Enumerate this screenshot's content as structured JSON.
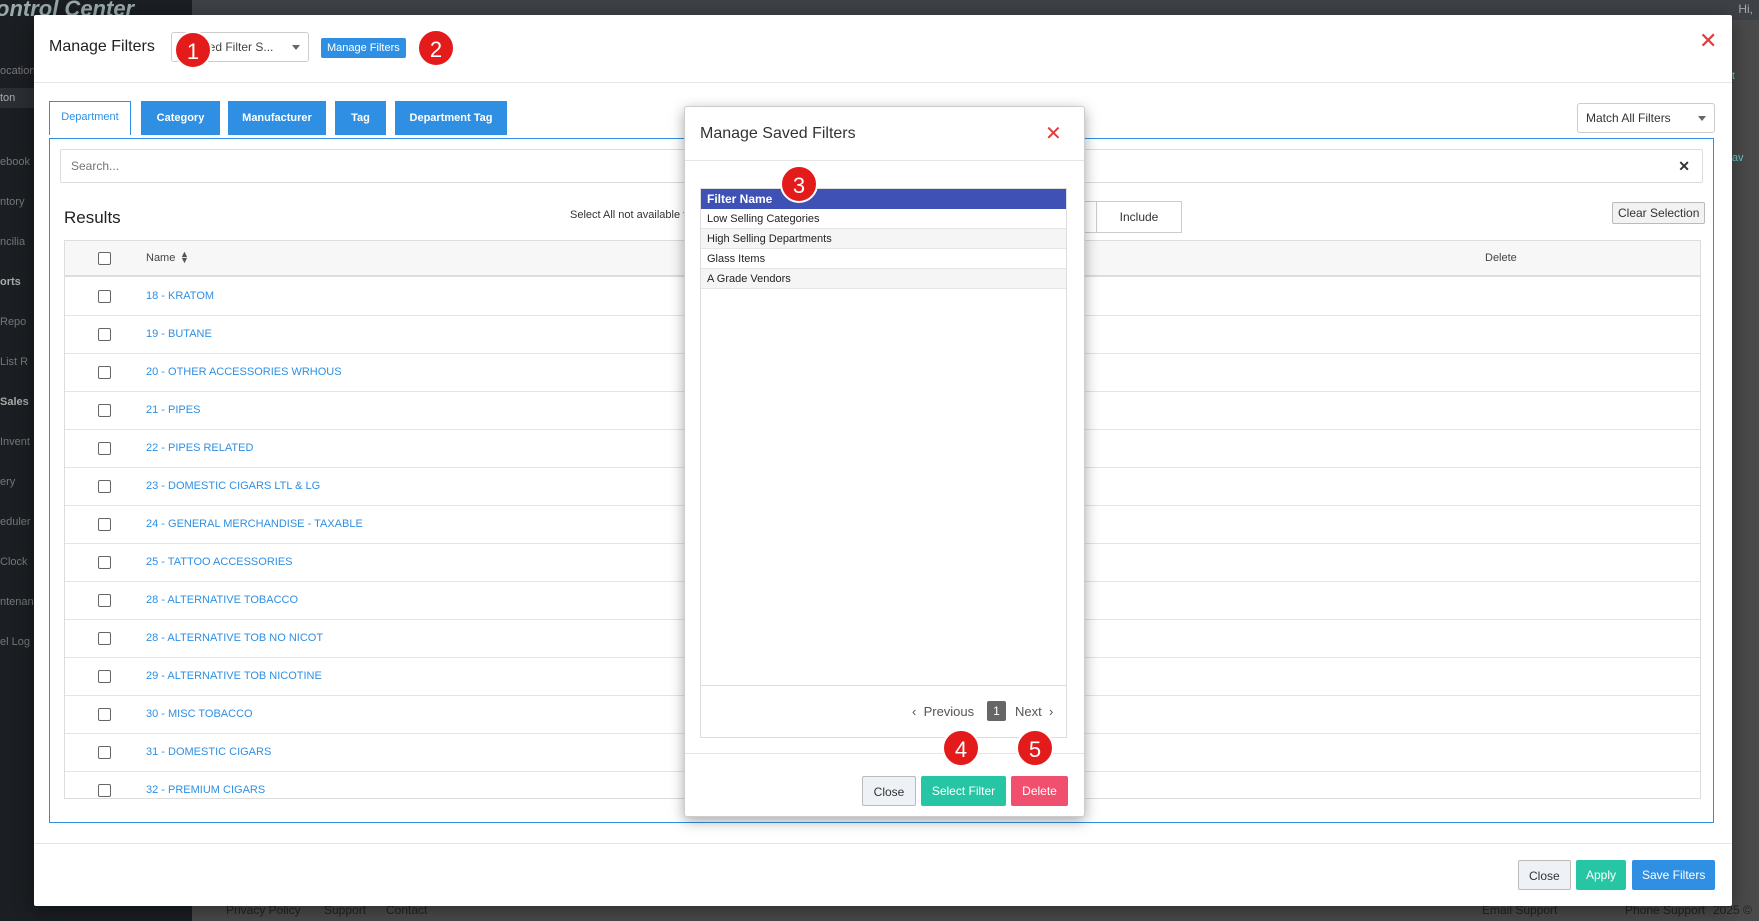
{
  "background": {
    "brand": "ontrol Center",
    "sidebar_items": [
      "ocation",
      "ton",
      "ebook",
      "ntory",
      "ncilia",
      "orts",
      "Repo",
      "List R",
      "Sales",
      "Invent",
      "ery",
      "eduler",
      "Clock",
      "ntenan",
      "el Log"
    ],
    "topbar_right": "Hi,",
    "right_badges": [
      "erat",
      "e Fav"
    ],
    "footer_left": [
      "Privacy Policy",
      "Support",
      "Contact"
    ],
    "footer_right": [
      "Email Support",
      "Phone Support",
      "2025 ©"
    ]
  },
  "manage_filters_modal": {
    "title": "Manage Filters",
    "saved_filter_select": "aved Filter S...",
    "manage_button": "Manage Filters",
    "tabs": [
      "Department",
      "Category",
      "Manufacturer",
      "Tag",
      "Department Tag"
    ],
    "active_tab": "Department",
    "match_select": "Match All Filters",
    "search_placeholder": "Search...",
    "search_clear": "✕",
    "results_title": "Results",
    "select_all_note": "Select All not available for",
    "include_button": "Include",
    "clear_selection": "Clear Selection",
    "columns": {
      "name": "Name",
      "delete": "Delete"
    },
    "rows": [
      "18 - KRATOM",
      "19 - BUTANE",
      "20 - OTHER ACCESSORIES WRHOUS",
      "21 - PIPES",
      "22 - PIPES RELATED",
      "23 - DOMESTIC CIGARS LTL & LG",
      "24 - GENERAL MERCHANDISE - TAXABLE",
      "25 - TATTOO ACCESSORIES",
      "28 - ALTERNATIVE TOBACCO",
      "28 - ALTERNATIVE TOB NO NICOT",
      "29 - ALTERNATIVE TOB NICOTINE",
      "30 - MISC TOBACCO",
      "31 - DOMESTIC CIGARS",
      "32 - PREMIUM CIGARS"
    ],
    "footer": {
      "close": "Close",
      "apply": "Apply",
      "save": "Save Filters"
    }
  },
  "saved_filters_modal": {
    "title": "Manage Saved Filters",
    "column": "Filter Name",
    "filters": [
      "Low Selling Categories",
      "High Selling Departments",
      "Glass Items",
      "A Grade Vendors"
    ],
    "pager": {
      "previous": "Previous",
      "page": "1",
      "next": "Next"
    },
    "buttons": {
      "close": "Close",
      "select": "Select Filter",
      "delete": "Delete"
    }
  },
  "callouts": [
    "1",
    "2",
    "3",
    "4",
    "5"
  ],
  "colors": {
    "primary": "#2f8fe3",
    "success": "#26c6a5",
    "danger": "#f0506e",
    "grid_header": "#3f51b5",
    "callout": "#e31b1b"
  }
}
